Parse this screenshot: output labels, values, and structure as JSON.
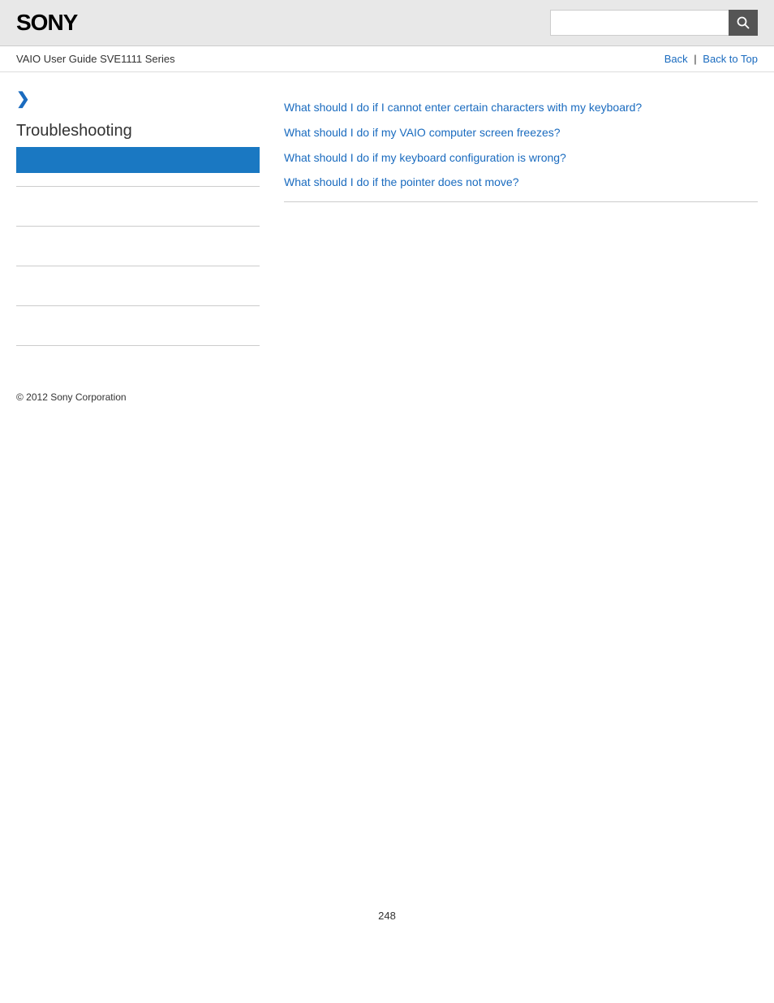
{
  "header": {
    "logo": "SONY",
    "search_placeholder": "",
    "search_button_icon": "🔍"
  },
  "nav": {
    "guide_title": "VAIO User Guide SVE1111 Series",
    "back_label": "Back",
    "back_to_top_label": "Back to Top"
  },
  "sidebar": {
    "chevron": "❯",
    "heading": "Troubleshooting"
  },
  "content": {
    "links": [
      "What should I do if I cannot enter certain characters with my keyboard?",
      "What should I do if my VAIO computer screen freezes?",
      "What should I do if my keyboard configuration is wrong?",
      "What should I do if the pointer does not move?"
    ]
  },
  "footer": {
    "copyright": "© 2012 Sony Corporation"
  },
  "page_number": "248"
}
